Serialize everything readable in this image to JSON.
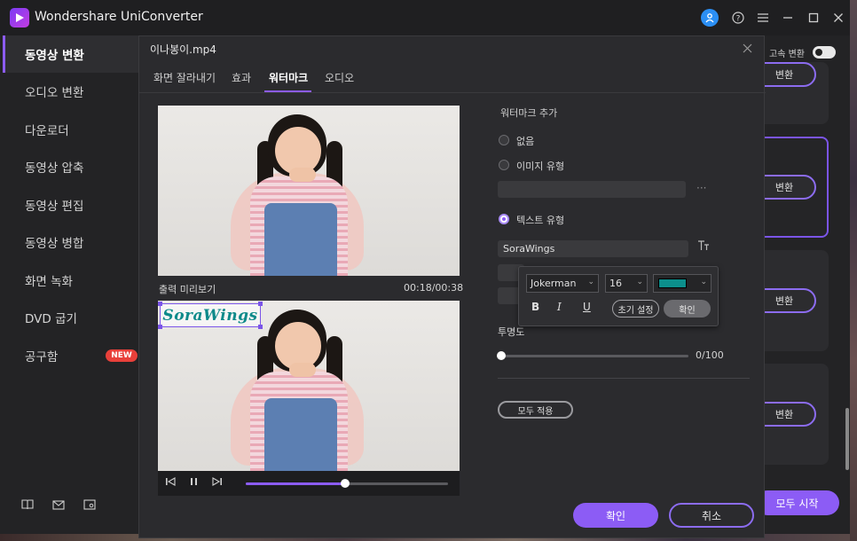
{
  "app": {
    "title": "Wondershare UniConverter"
  },
  "sidebar": {
    "items": [
      {
        "label": "동영상 변환"
      },
      {
        "label": "오디오 변환"
      },
      {
        "label": "다운로더"
      },
      {
        "label": "동영상 압축"
      },
      {
        "label": "동영상 편집"
      },
      {
        "label": "동영상 병합"
      },
      {
        "label": "화면 녹화"
      },
      {
        "label": "DVD 굽기"
      },
      {
        "label": "공구함"
      }
    ],
    "new_badge": "NEW"
  },
  "background": {
    "speed_toggle_label": "고속 변환",
    "convert_label": "변환",
    "start_all": "모두 시작"
  },
  "modal": {
    "title": "이나봉이.mp4",
    "tabs": [
      "화면 잘라내기",
      "효과",
      "워터마크",
      "오디오"
    ],
    "preview_label": "출력 미리보기",
    "time": "00:18/00:38",
    "watermark_text_overlay": "SoraWings",
    "playback_progress": 0.49,
    "settings": {
      "section_label": "워터마크 추가",
      "option_none": "없음",
      "option_image": "이미지 유형",
      "option_text": "텍스트 유형",
      "image_more": "···",
      "text_value": "SoraWings",
      "text_style_icon": "T̲T",
      "opacity_label": "투명도",
      "opacity_value": "0/100",
      "opacity_level": 0.0,
      "apply_all": "모두 적용"
    },
    "font_popup": {
      "font": "Jokerman",
      "size": "16",
      "color": "#0c8f8c",
      "bold": "B",
      "italic": "I",
      "underline": "U",
      "reset": "초기 설정",
      "ok": "확인"
    },
    "ok": "확인",
    "cancel": "취소"
  },
  "colors": {
    "accent": "#8c5cf5",
    "background": "#2b2b2e"
  }
}
